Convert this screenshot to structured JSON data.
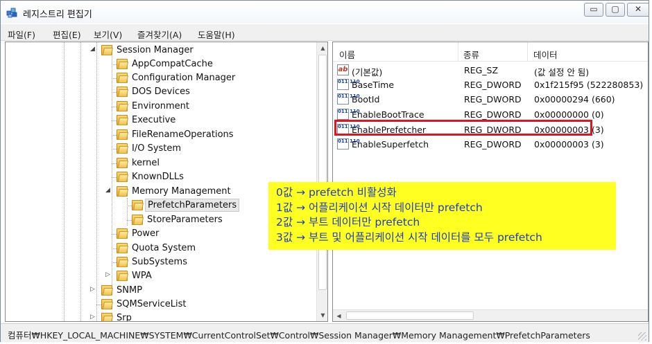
{
  "window": {
    "title": "레지스트리 편집기",
    "min_symbol": "▭",
    "max_symbol": "▢",
    "close_symbol": "✕"
  },
  "menu": [
    "파일(F)",
    "편집(E)",
    "보기(V)",
    "즐겨찾기(A)",
    "도움말(H)"
  ],
  "tree": {
    "items": [
      {
        "label": "Session Manager",
        "expander": "◢",
        "level": 0
      },
      {
        "label": "AppCompatCache",
        "expander": "",
        "level": 1
      },
      {
        "label": "Configuration Manager",
        "expander": "",
        "level": 1
      },
      {
        "label": "DOS Devices",
        "expander": "",
        "level": 1
      },
      {
        "label": "Environment",
        "expander": "",
        "level": 1
      },
      {
        "label": "Executive",
        "expander": "",
        "level": 1
      },
      {
        "label": "FileRenameOperations",
        "expander": "",
        "level": 1
      },
      {
        "label": "I/O System",
        "expander": "",
        "level": 1
      },
      {
        "label": "kernel",
        "expander": "",
        "level": 1
      },
      {
        "label": "KnownDLLs",
        "expander": "",
        "level": 1
      },
      {
        "label": "Memory Management",
        "expander": "◢",
        "level": 1
      },
      {
        "label": "PrefetchParameters",
        "expander": "",
        "level": 2,
        "selected": true
      },
      {
        "label": "StoreParameters",
        "expander": "",
        "level": 2
      },
      {
        "label": "Power",
        "expander": "",
        "level": 1
      },
      {
        "label": "Quota System",
        "expander": "",
        "level": 1
      },
      {
        "label": "SubSystems",
        "expander": "",
        "level": 1
      },
      {
        "label": "WPA",
        "expander": "▷",
        "level": 1
      },
      {
        "label": "SNMP",
        "expander": "▷",
        "level": 0
      },
      {
        "label": "SQMServiceList",
        "expander": "",
        "level": 0
      },
      {
        "label": "Srp",
        "expander": "▷",
        "level": 0
      }
    ]
  },
  "list": {
    "columns": [
      "이름",
      "종류",
      "데이터"
    ],
    "rows": [
      {
        "name": "(기본값)",
        "type": "REG_SZ",
        "data": "(값 설정 안 됨)",
        "icon": "string-value-icon",
        "icon_text": "ab"
      },
      {
        "name": "BaseTime",
        "type": "REG_DWORD",
        "data": "0x1f215f95 (522280853)",
        "icon": "binary-value-icon",
        "icon_text": "011 110"
      },
      {
        "name": "BootId",
        "type": "REG_DWORD",
        "data": "0x00000294 (660)",
        "icon": "binary-value-icon",
        "icon_text": "011 110"
      },
      {
        "name": "EnableBootTrace",
        "type": "REG_DWORD",
        "data": "0x00000000 (0)",
        "icon": "binary-value-icon",
        "icon_text": "011 110"
      },
      {
        "name": "EnablePrefetcher",
        "type": "REG_DWORD",
        "data": "0x00000003 (3)",
        "icon": "binary-value-icon",
        "icon_text": "011 110"
      },
      {
        "name": "EnableSuperfetch",
        "type": "REG_DWORD",
        "data": "0x00000003 (3)",
        "icon": "binary-value-icon",
        "icon_text": "011 110"
      }
    ]
  },
  "annotation": {
    "lines": [
      "0값 → prefetch 비활성화",
      "1값 → 어플리케이션 시작 데이터만 prefetch",
      "2값 → 부트 데이터만 prefetch",
      "3값 → 부트 및 어플리케이션 시작 데이터를 모두 prefetch"
    ],
    "background": "#ffff22",
    "text_color": "#1f3dbf"
  },
  "status": {
    "path": "컴퓨터₩HKEY_LOCAL_MACHINE₩SYSTEM₩CurrentControlSet₩Control₩Session Manager₩Memory Management₩PrefetchParameters"
  },
  "colors": {
    "highlight_border": "#e0141e"
  }
}
